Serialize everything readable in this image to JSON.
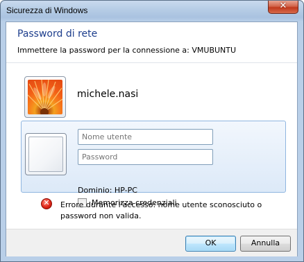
{
  "window": {
    "title": "Sicurezza di Windows",
    "close_glyph": "✕"
  },
  "dialog": {
    "heading": "Password di rete",
    "subheading": "Immettere la password per la connessione a: VMUBUNTU"
  },
  "account": {
    "name": "michele.nasi",
    "picture_icon": "flower-icon"
  },
  "credentials": {
    "username_placeholder": "Nome utente",
    "username_value": "",
    "password_placeholder": "Password",
    "password_value": "",
    "domain_label": "Dominio: HP-PC",
    "remember_label": "Memorizza credenziali",
    "remember_checked": false
  },
  "error": {
    "icon": "error-icon",
    "glyph": "✕",
    "message": "Errore durante l'accesso: nome utente sconosciuto o password non valida."
  },
  "buttons": {
    "ok_label": "OK",
    "cancel_label": "Annulla"
  },
  "colors": {
    "heading": "#1c3d8c",
    "panel_border": "#8fb5e0",
    "close_button": "#c0391c"
  }
}
